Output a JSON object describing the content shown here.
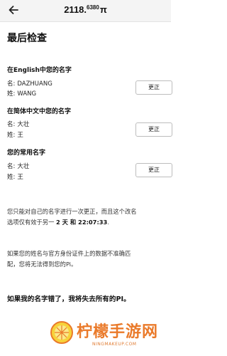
{
  "header": {
    "balance_int": "2118.",
    "balance_dec": "6380",
    "currency": "π"
  },
  "page": {
    "title": "最后检查"
  },
  "english_name": {
    "heading": "在English中您的名字",
    "first_label": "名:",
    "first_value": "DAZHUANG",
    "last_label": "姓:",
    "last_value": "WANG",
    "button": "更正"
  },
  "simplified_name": {
    "heading": "在简体中文中您的名字",
    "first_label": "名:",
    "first_value": "大壮",
    "last_label": "姓:",
    "last_value": "王",
    "button": "更正"
  },
  "common_name": {
    "heading": "您的常用名字",
    "first_label": "名:",
    "first_value": "大壮",
    "last_label": "姓:",
    "last_value": "王",
    "button": "更正"
  },
  "notice1": {
    "line1": "您只能对自己的名字进行一次更正，而且这个改名",
    "line2_prefix": "选项仅有效于另一 ",
    "time_bold": "2 天 和 22:07:33",
    "line2_suffix": "."
  },
  "notice2": {
    "line1": "如果您的姓名与官方身份证件上的数据不准确匹",
    "line2": "配，您将无法得到您的Pi。"
  },
  "warning": "如果我的名字错了，我将失去所有的PI。",
  "watermark": {
    "text": "柠檬手游网",
    "url": "NINGMAKEUP.COM"
  },
  "colors": {
    "watermark": "#ea7a2a"
  }
}
